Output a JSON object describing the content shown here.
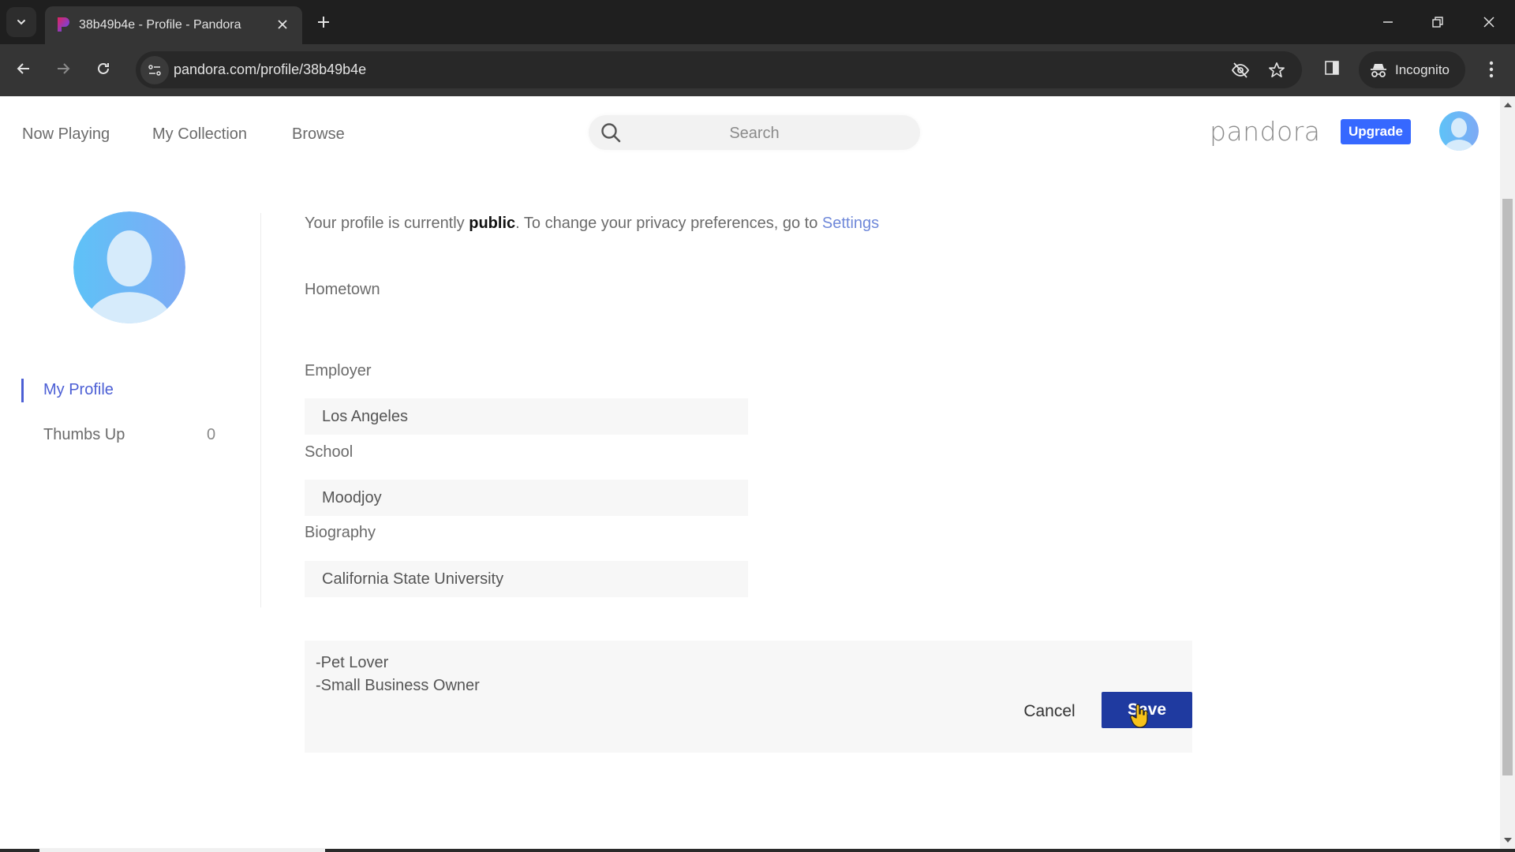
{
  "browser": {
    "tab_title": "38b49b4e - Profile - Pandora",
    "url": "pandora.com/profile/38b49b4e",
    "incognito_label": "Incognito"
  },
  "header": {
    "nav": [
      "Now Playing",
      "My Collection",
      "Browse"
    ],
    "search_placeholder": "Search",
    "logo": "pandora",
    "upgrade_label": "Upgrade"
  },
  "sidebar": {
    "items": [
      {
        "label": "My Profile",
        "active": true
      },
      {
        "label": "Thumbs Up",
        "count": "0"
      }
    ]
  },
  "privacy": {
    "prefix": "Your profile is currently ",
    "status": "public",
    "middle": ". To change your privacy preferences, go to ",
    "link": "Settings"
  },
  "form": {
    "hometown": {
      "label": "Hometown",
      "value": "Los Angeles"
    },
    "employer": {
      "label": "Employer",
      "value": "Moodjoy"
    },
    "school": {
      "label": "School",
      "value": "California State University"
    },
    "biography": {
      "label": "Biography",
      "value": "-Pet Lover\n-Small Business Owner"
    },
    "cancel_label": "Cancel",
    "save_label": "Save"
  },
  "colors": {
    "accent": "#3668ff",
    "save": "#1f3aa0",
    "link": "#6f88d9",
    "active_nav": "#4c5fd5"
  }
}
